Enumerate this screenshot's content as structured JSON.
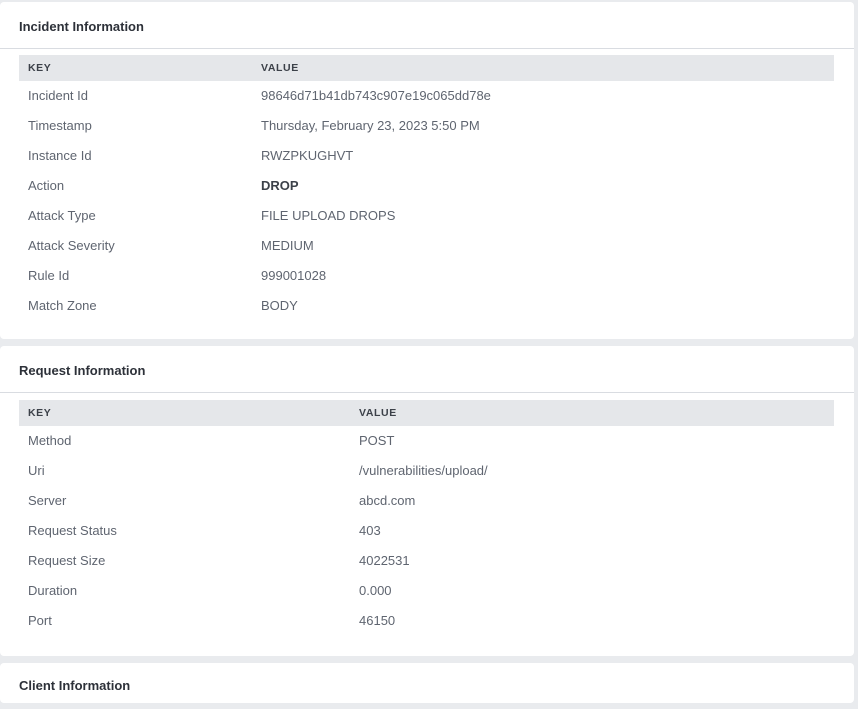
{
  "incident": {
    "title": "Incident Information",
    "key_header": "KEY",
    "value_header": "VALUE",
    "rows": [
      {
        "key": "Incident Id",
        "value": "98646d71b41db743c907e19c065dd78e"
      },
      {
        "key": "Timestamp",
        "value": "Thursday, February 23, 2023 5:50 PM"
      },
      {
        "key": "Instance Id",
        "value": "RWZPKUGHVT"
      },
      {
        "key": "Action",
        "value": "DROP"
      },
      {
        "key": "Attack Type",
        "value": "FILE UPLOAD DROPS"
      },
      {
        "key": "Attack Severity",
        "value": "MEDIUM"
      },
      {
        "key": "Rule Id",
        "value": "999001028"
      },
      {
        "key": "Match Zone",
        "value": "BODY"
      }
    ]
  },
  "request": {
    "title": "Request Information",
    "key_header": "KEY",
    "value_header": "VALUE",
    "rows": [
      {
        "key": "Method",
        "value": "POST"
      },
      {
        "key": "Uri",
        "value": "/vulnerabilities/upload/"
      },
      {
        "key": "Server",
        "value": "abcd.com"
      },
      {
        "key": "Request Status",
        "value": "403"
      },
      {
        "key": "Request Size",
        "value": "4022531"
      },
      {
        "key": "Duration",
        "value": "0.000"
      },
      {
        "key": "Port",
        "value": "46150"
      }
    ]
  },
  "client": {
    "title": "Client Information"
  }
}
